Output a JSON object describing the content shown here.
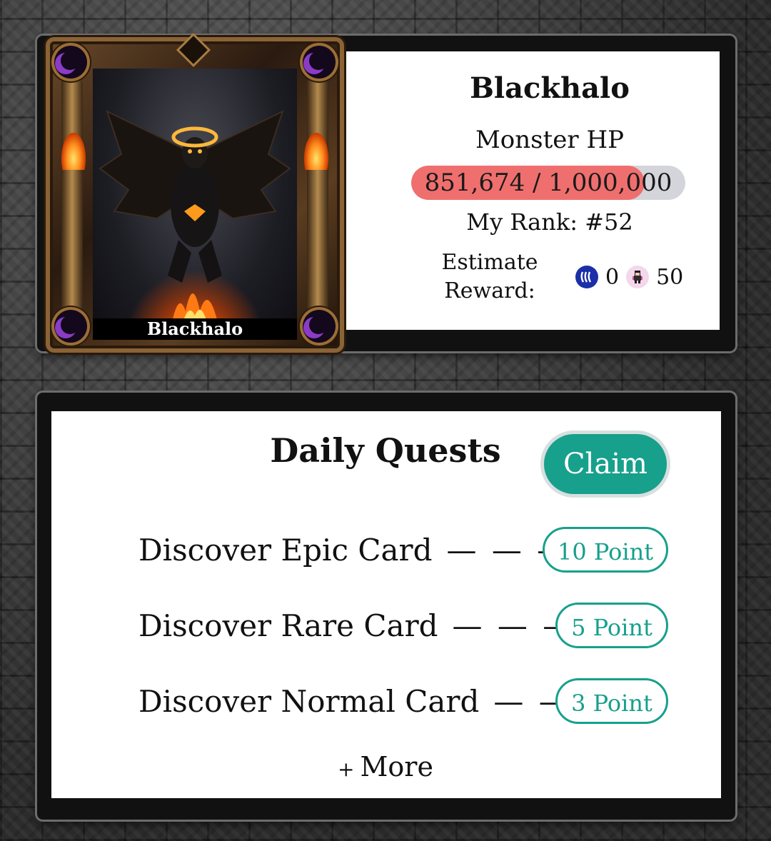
{
  "card": {
    "name_label": "Blackhalo",
    "moon_icon": "moon-icon",
    "accent": "#9b6e35"
  },
  "monster": {
    "title": "Blackhalo",
    "hp_label": "Monster HP",
    "hp_current": 851674,
    "hp_max": 1000000,
    "hp_text": "851,674 / 1,000,000",
    "hp_fill_color": "#ef6f6e",
    "hp_track_color": "#d3d5da"
  },
  "rank": {
    "text": "My Rank: #52"
  },
  "reward": {
    "label": "Estimate Reward:",
    "items": [
      {
        "icon": "steem-coin-icon",
        "value": "0"
      },
      {
        "icon": "pixel-character-token-icon",
        "value": "50"
      }
    ]
  },
  "quests": {
    "title": "Daily Quests",
    "claim_label": "Claim",
    "accent": "#17a08c",
    "items": [
      {
        "label": "Discover Epic Card",
        "dashes": "— — —",
        "points": "10 Point"
      },
      {
        "label": "Discover Rare Card",
        "dashes": "— — — -",
        "points": "5 Point"
      },
      {
        "label": "Discover Normal Card",
        "dashes": "— — ·",
        "points": "3 Point"
      }
    ],
    "more_plus": "+",
    "more_label": "More"
  }
}
